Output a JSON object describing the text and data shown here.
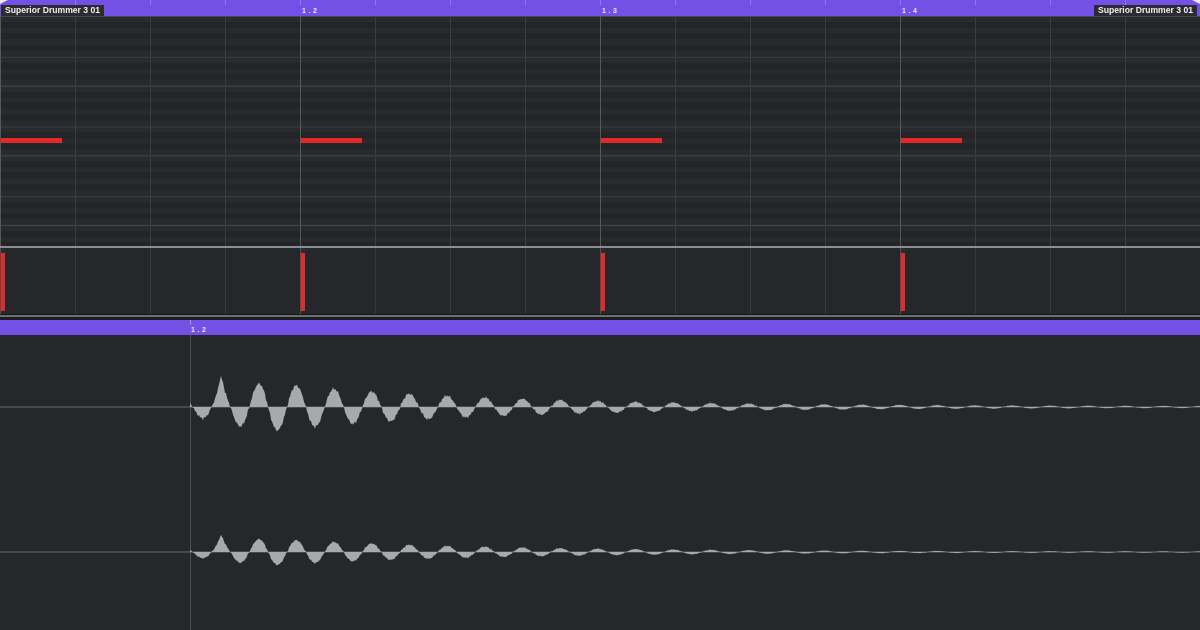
{
  "piano_roll": {
    "ruler": {
      "region_labels": [
        "Superior Drummer 3 01",
        "Superior Drummer 3 01"
      ]
    },
    "beats": [
      {
        "note": true,
        "velocity": {
          "level": 0.92
        }
      },
      {
        "marker": "1 . 2",
        "note": true,
        "velocity": {
          "level": 0.92
        }
      },
      {
        "marker": "1 . 3",
        "note": true,
        "velocity": {
          "level": 0.92
        }
      },
      {
        "marker": "1 . 4",
        "note": true,
        "velocity": {
          "level": 0.92
        }
      }
    ]
  },
  "audio_editor": {
    "ruler": {
      "marker": "1 . 2"
    }
  }
}
